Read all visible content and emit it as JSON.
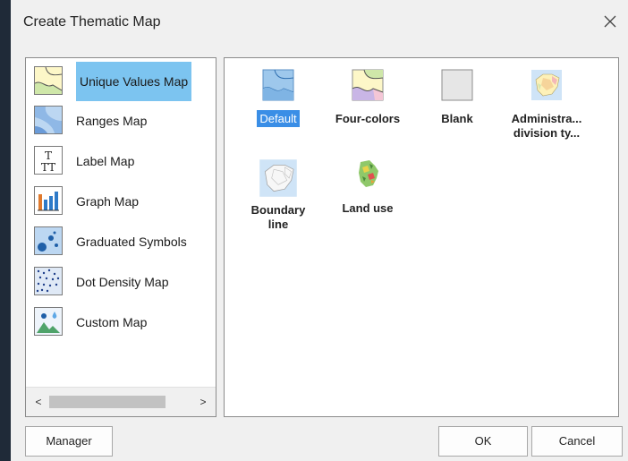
{
  "dialog": {
    "title": "Create Thematic Map",
    "close_icon": "close-icon"
  },
  "map_types": [
    {
      "label": "Unique Values Map",
      "icon": "unique-values-map-icon",
      "selected": true
    },
    {
      "label": "Ranges Map",
      "icon": "ranges-map-icon",
      "selected": false
    },
    {
      "label": "Label Map",
      "icon": "label-map-icon",
      "selected": false
    },
    {
      "label": "Graph Map",
      "icon": "graph-map-icon",
      "selected": false
    },
    {
      "label": "Graduated Symbols",
      "icon": "graduated-symbols-icon",
      "selected": false
    },
    {
      "label": "Dot Density Map",
      "icon": "dot-density-map-icon",
      "selected": false
    },
    {
      "label": "Custom Map",
      "icon": "custom-map-icon",
      "selected": false
    }
  ],
  "scrollbar": {
    "left_arrow": "<",
    "right_arrow": ">"
  },
  "templates": [
    {
      "label": "Default",
      "icon": "default-template-icon",
      "selected": true
    },
    {
      "label": "Four-colors",
      "icon": "four-colors-template-icon",
      "selected": false
    },
    {
      "label": "Blank",
      "icon": "blank-template-icon",
      "selected": false
    },
    {
      "label": "Administra... division ty...",
      "line1": "Administra...",
      "line2": "division ty...",
      "icon": "administrative-division-template-icon",
      "selected": false
    },
    {
      "label": "Boundary line",
      "line1": "Boundary",
      "line2": "line",
      "icon": "boundary-line-template-icon",
      "selected": false
    },
    {
      "label": "Land use",
      "icon": "land-use-template-icon",
      "selected": false
    }
  ],
  "buttons": {
    "manager": "Manager",
    "ok": "OK",
    "cancel": "Cancel"
  },
  "colors": {
    "selection_light": "#7cc4f0",
    "selection_accent": "#3a8ee6"
  }
}
